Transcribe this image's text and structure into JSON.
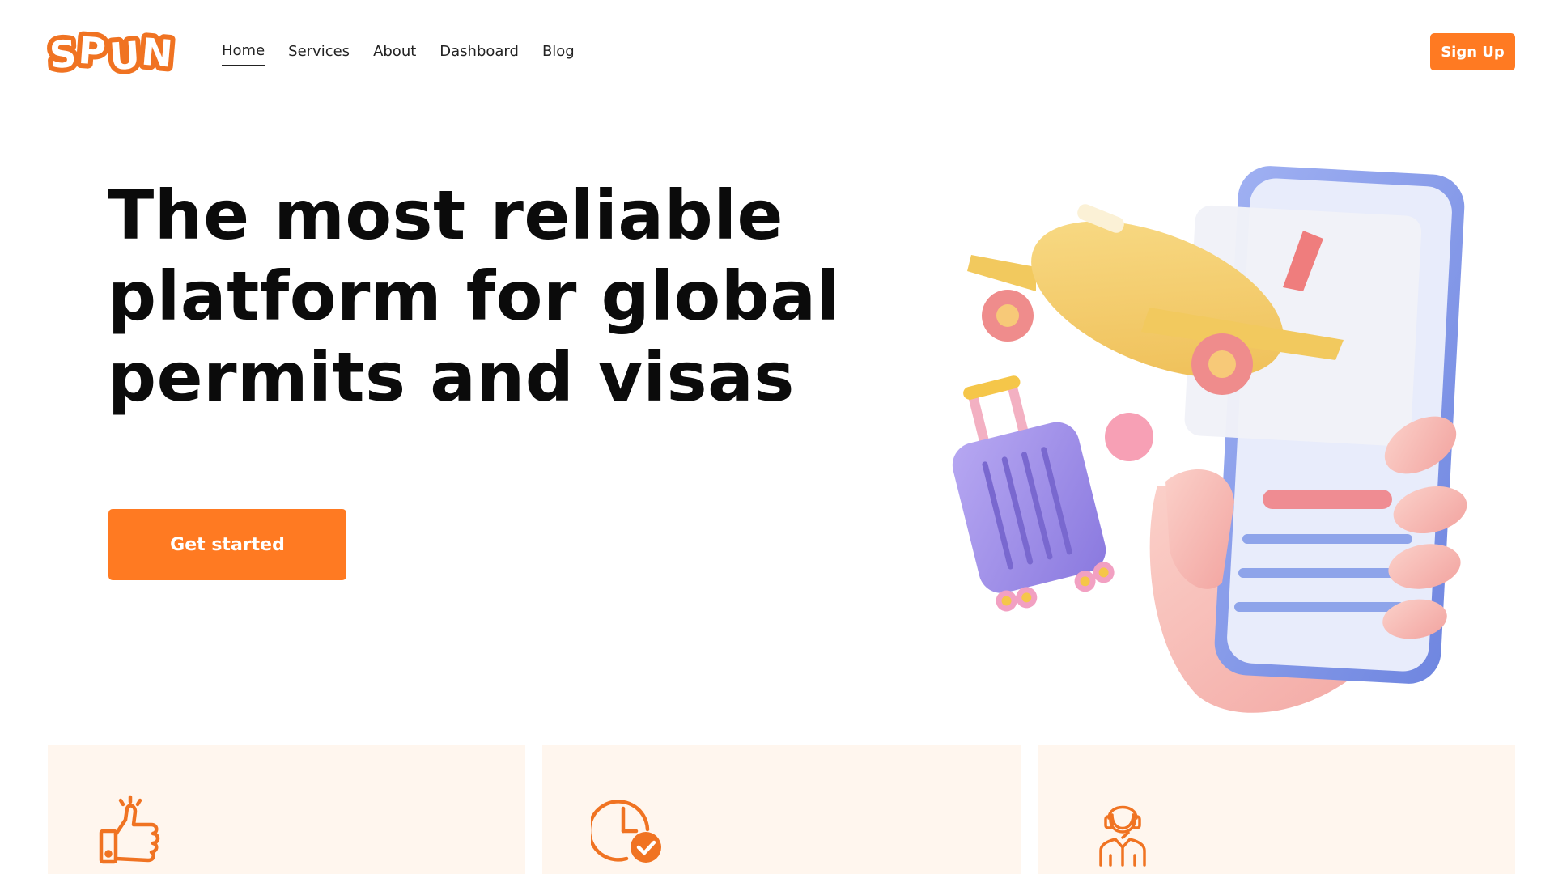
{
  "brand": {
    "logo_text": "SPUN",
    "accent": "#ff7a22"
  },
  "nav": {
    "items": [
      {
        "label": "Home",
        "active": true
      },
      {
        "label": "Services",
        "active": false
      },
      {
        "label": "About",
        "active": false
      },
      {
        "label": "Dashboard",
        "active": false
      },
      {
        "label": "Blog",
        "active": false
      }
    ],
    "signup_label": "Sign Up"
  },
  "hero": {
    "title_lines": [
      "The most reliable",
      "platform for global",
      "permits and visas"
    ],
    "cta_label": "Get started",
    "illustration": "hand-holding-phone-with-airplane-and-suitcase"
  },
  "features": [
    {
      "icon": "thumbs-up-icon"
    },
    {
      "icon": "clock-check-icon"
    },
    {
      "icon": "support-agent-icon"
    }
  ]
}
